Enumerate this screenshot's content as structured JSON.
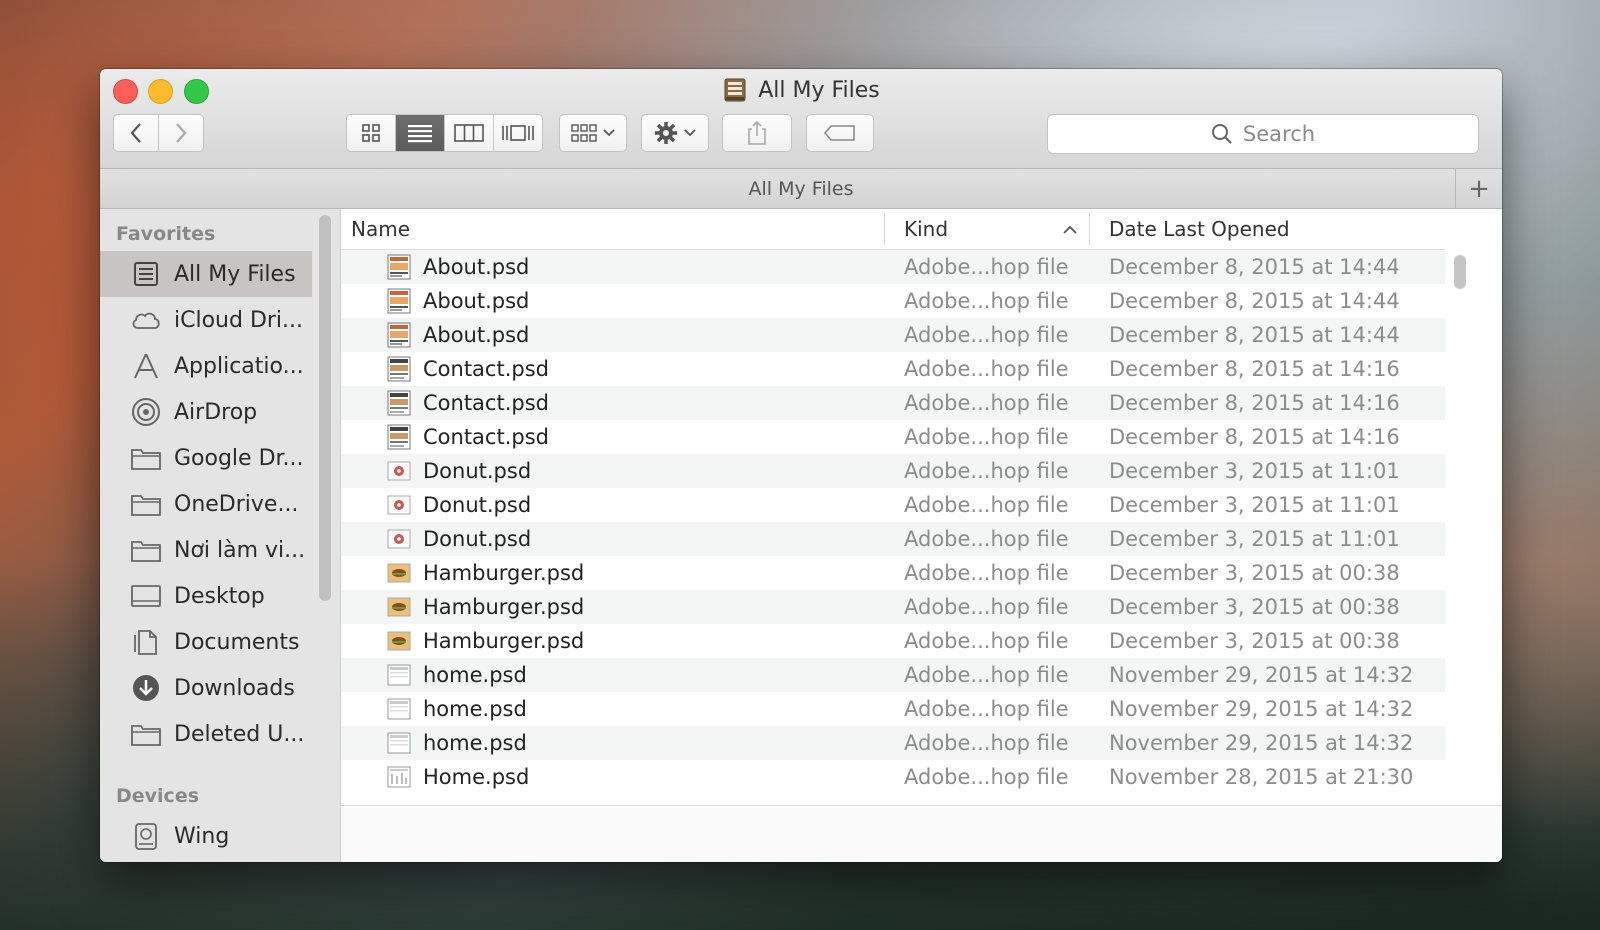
{
  "window": {
    "title": "All My Files"
  },
  "toolbar": {
    "search_placeholder": "Search",
    "view_modes": [
      "icon-view",
      "list-view",
      "column-view",
      "cover-flow-view"
    ],
    "active_view": "list-view"
  },
  "pathbar": {
    "label": "All My Files",
    "add_label": "+"
  },
  "sidebar": {
    "favorites_header": "Favorites",
    "devices_header": "Devices",
    "favorites": [
      {
        "label": "All My Files",
        "icon": "all-my-files-icon",
        "selected": true
      },
      {
        "label": "iCloud Dri...",
        "icon": "cloud-icon"
      },
      {
        "label": "Applicatio...",
        "icon": "applications-icon"
      },
      {
        "label": "AirDrop",
        "icon": "airdrop-icon"
      },
      {
        "label": "Google Dr...",
        "icon": "folder-icon"
      },
      {
        "label": "OneDrive...",
        "icon": "folder-icon"
      },
      {
        "label": "Nơi làm vi...",
        "icon": "folder-icon"
      },
      {
        "label": "Desktop",
        "icon": "desktop-icon"
      },
      {
        "label": "Documents",
        "icon": "documents-icon"
      },
      {
        "label": "Downloads",
        "icon": "downloads-icon"
      },
      {
        "label": "Deleted U...",
        "icon": "folder-icon"
      }
    ],
    "devices": [
      {
        "label": "Wing",
        "icon": "disk-icon"
      }
    ]
  },
  "columns": {
    "name": "Name",
    "kind": "Kind",
    "date": "Date Last Opened"
  },
  "files": [
    {
      "name": "About.psd",
      "kind": "Adobe...hop file",
      "date": "December 8, 2015 at 14:44",
      "thumb": "about"
    },
    {
      "name": "About.psd",
      "kind": "Adobe...hop file",
      "date": "December 8, 2015 at 14:44",
      "thumb": "about"
    },
    {
      "name": "About.psd",
      "kind": "Adobe...hop file",
      "date": "December 8, 2015 at 14:44",
      "thumb": "about"
    },
    {
      "name": "Contact.psd",
      "kind": "Adobe...hop file",
      "date": "December 8, 2015 at 14:16",
      "thumb": "contact"
    },
    {
      "name": "Contact.psd",
      "kind": "Adobe...hop file",
      "date": "December 8, 2015 at 14:16",
      "thumb": "contact"
    },
    {
      "name": "Contact.psd",
      "kind": "Adobe...hop file",
      "date": "December 8, 2015 at 14:16",
      "thumb": "contact"
    },
    {
      "name": "Donut.psd",
      "kind": "Adobe...hop file",
      "date": "December 3, 2015 at 11:01",
      "thumb": "donut"
    },
    {
      "name": "Donut.psd",
      "kind": "Adobe...hop file",
      "date": "December 3, 2015 at 11:01",
      "thumb": "donut"
    },
    {
      "name": "Donut.psd",
      "kind": "Adobe...hop file",
      "date": "December 3, 2015 at 11:01",
      "thumb": "donut"
    },
    {
      "name": "Hamburger.psd",
      "kind": "Adobe...hop file",
      "date": "December 3, 2015 at 00:38",
      "thumb": "hamburger"
    },
    {
      "name": "Hamburger.psd",
      "kind": "Adobe...hop file",
      "date": "December 3, 2015 at 00:38",
      "thumb": "hamburger"
    },
    {
      "name": "Hamburger.psd",
      "kind": "Adobe...hop file",
      "date": "December 3, 2015 at 00:38",
      "thumb": "hamburger"
    },
    {
      "name": "home.psd",
      "kind": "Adobe...hop file",
      "date": "November 29, 2015 at 14:32",
      "thumb": "home"
    },
    {
      "name": "home.psd",
      "kind": "Adobe...hop file",
      "date": "November 29, 2015 at 14:32",
      "thumb": "home"
    },
    {
      "name": "home.psd",
      "kind": "Adobe...hop file",
      "date": "November 29, 2015 at 14:32",
      "thumb": "home"
    },
    {
      "name": "Home.psd",
      "kind": "Adobe...hop file",
      "date": "November 28, 2015 at 21:30",
      "thumb": "home2"
    }
  ],
  "colors": {
    "close": "#fc5f57",
    "minimize": "#fdbc2e",
    "maximize": "#33c748",
    "selection": "#c9c4c4"
  }
}
